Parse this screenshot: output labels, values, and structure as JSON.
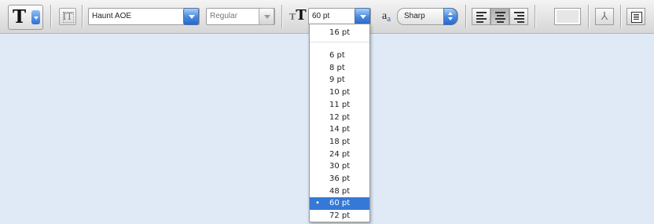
{
  "toolbar": {
    "tool_preset_glyph": "T",
    "orientation_glyph": "IT",
    "font_family": "Haunt AOE",
    "font_style": "Regular",
    "size_icon_glyph": "T",
    "font_size": "60 pt",
    "antialias_icon": "a",
    "antialias_icon_sub": "a",
    "antialias": "Sharp",
    "warp_glyph": "⅄"
  },
  "size_menu": {
    "current": "16 pt",
    "items": [
      "6 pt",
      "8 pt",
      "9 pt",
      "10 pt",
      "11 pt",
      "12 pt",
      "14 pt",
      "18 pt",
      "24 pt",
      "30 pt",
      "36 pt",
      "48 pt",
      "60 pt",
      "72 pt"
    ],
    "selected": "60 pt",
    "check_glyph": "•"
  },
  "colors": {
    "background": "#dfeaf6",
    "selection": "#3579d6",
    "accent_button": "#4b8ce0"
  }
}
